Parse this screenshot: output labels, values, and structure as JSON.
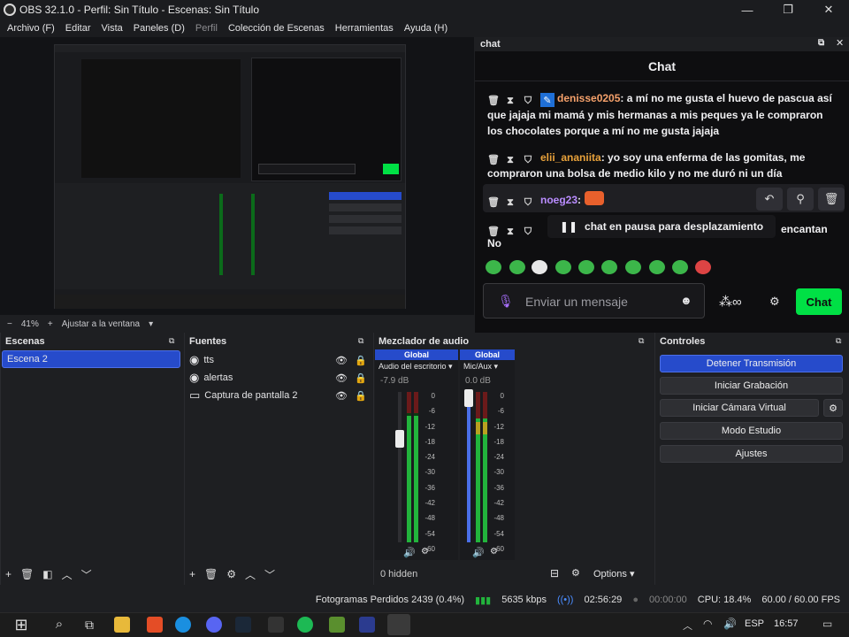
{
  "window": {
    "title": "OBS 32.1.0 - Perfil: Sin Título - Escenas: Sin Título",
    "minimize": "—",
    "maximize": "❐",
    "close": "✕"
  },
  "menu": [
    {
      "label": "Archivo (F)"
    },
    {
      "label": "Editar"
    },
    {
      "label": "Vista"
    },
    {
      "label": "Paneles (D)"
    },
    {
      "label": "Perfil"
    },
    {
      "label": "Colección de Escenas"
    },
    {
      "label": "Herramientas"
    },
    {
      "label": "Ayuda (H)"
    }
  ],
  "preview": {
    "zoom_minus": "−",
    "zoom_level": "41%",
    "zoom_plus": "+",
    "fit_label": "Ajustar a la ventana"
  },
  "chat": {
    "dock_title": "chat",
    "header": "Chat",
    "messages": [
      {
        "user": "denisse0205",
        "text": ": a mí no me gusta el huevo de pascua así que jajaja mi mamá y mis hermanas a mis peques ya le compraron los chocolates porque a mí no me gusta jajaja"
      },
      {
        "user": "elii_ananiita",
        "text": ": yo soy una enferma de las gomitas, me compraron una bolsa de medio kilo y no me duró ni un día"
      },
      {
        "user": "noeg23",
        "text": ":"
      },
      {
        "user": "",
        "text": "encantan"
      },
      {
        "user": "",
        "text": "No"
      }
    ],
    "pause_banner": "chat en pausa para desplazamiento",
    "input_placeholder": "Enviar un mensaje",
    "send_button": "Chat"
  },
  "scenes": {
    "title": "Escenas",
    "items": [
      "Escena 2"
    ]
  },
  "sources": {
    "title": "Fuentes",
    "items": [
      "tts",
      "alertas",
      "Captura de pantalla 2"
    ]
  },
  "mixer": {
    "title": "Mezclador de audio",
    "channels": [
      {
        "badge": "Global",
        "name": "Audio del escritorio",
        "db": "-7.9 dB",
        "level": 0.72
      },
      {
        "badge": "Global",
        "name": "Mic/Aux",
        "db": "0.0 dB",
        "level": 1.0
      }
    ],
    "scale": [
      "0",
      "-6",
      "-12",
      "-18",
      "-24",
      "-30",
      "-36",
      "-42",
      "-48",
      "-54",
      "-60"
    ],
    "hidden": "0 hidden",
    "options": "Options"
  },
  "controls": {
    "title": "Controles",
    "buttons": [
      "Detener Transmisión",
      "Iniciar Grabación",
      "Iniciar Cámara Virtual",
      "Modo Estudio",
      "Ajustes"
    ]
  },
  "status": {
    "dropped": "Fotogramas Perdidos 2439 (0.4%)",
    "bitrate": "5635 kbps",
    "stream_time": "02:56:29",
    "rec_time": "00:00:00",
    "cpu": "CPU: 18.4%",
    "fps": "60.00 / 60.00 FPS"
  },
  "taskbar": {
    "lang": "ESP",
    "time": "16:57"
  },
  "colors": {
    "accent": "#264bcb",
    "chat_green": "#00e045",
    "meter_green": "#0b6b1a"
  }
}
